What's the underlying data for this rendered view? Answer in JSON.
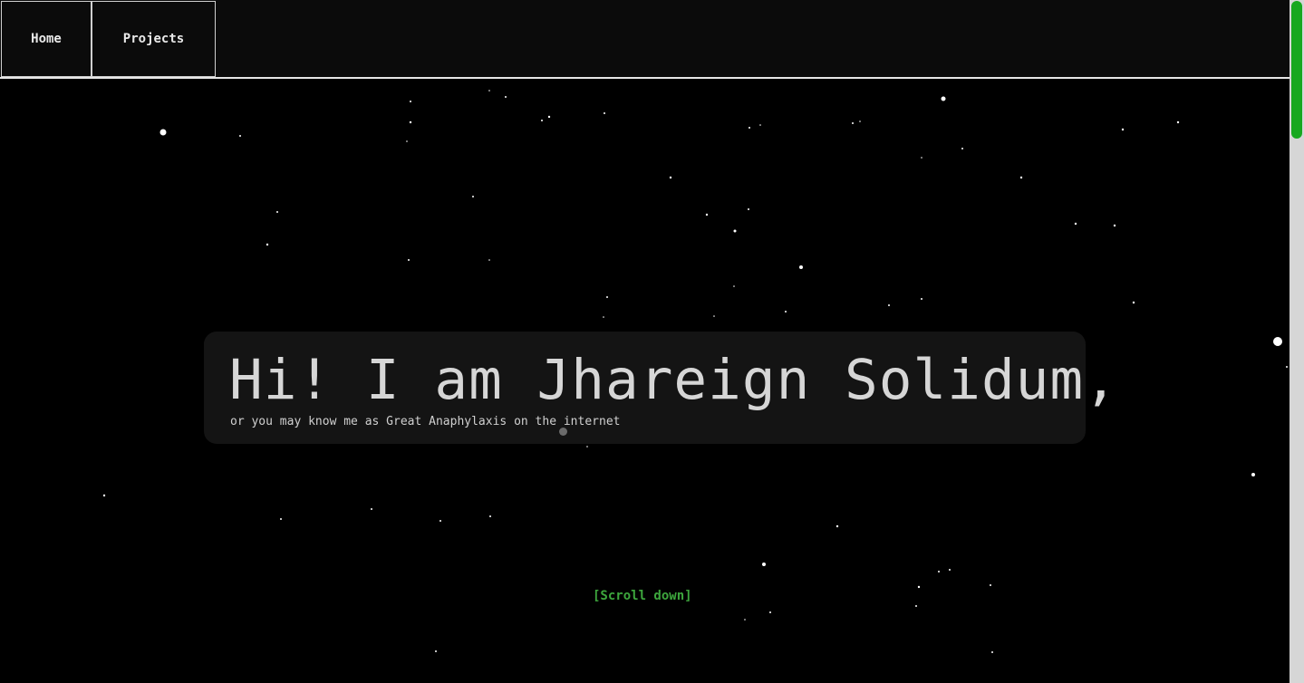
{
  "nav": {
    "home_label": "Home",
    "projects_label": "Projects"
  },
  "hero": {
    "title": "Hi! I am Jhareign Solidum,",
    "subtitle": "or you may know me as Great Anaphylaxis on the internet"
  },
  "scroll_prompt": "[Scroll down]",
  "colors": {
    "background": "#000000",
    "nav_background": "#0b0b0b",
    "hero_card": "#141414",
    "accent_green": "#3da63d",
    "scrollbar_thumb": "#17a81f"
  }
}
